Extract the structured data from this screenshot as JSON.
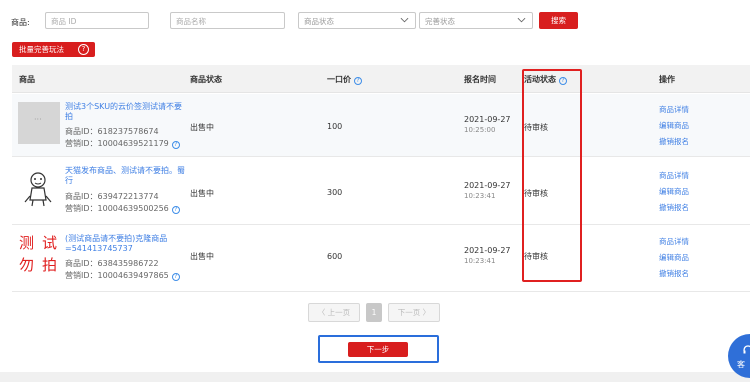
{
  "filters": {
    "label": "商品:",
    "product_id_placeholder": "商品 ID",
    "product_name_placeholder": "商品名称",
    "status_select": "商品状态",
    "completion_select": "完善状态",
    "search_button": "搜索"
  },
  "batch_button": {
    "label": "批量完善玩法",
    "help": "?"
  },
  "table": {
    "headers": {
      "product": "商品",
      "status": "商品状态",
      "price": "一口价",
      "signup_time": "报名时间",
      "activity_status": "活动状态",
      "actions": "操作"
    },
    "rows": [
      {
        "title": "测试3个SKU的云价签测试请不要拍",
        "product_id": "商品ID：618237578674",
        "marketing_id": "营销ID：10004639521179",
        "status": "出售中",
        "price": "100",
        "date": "2021-09-27",
        "time": "10:25:00",
        "activity_status": "待审核",
        "actions": [
          "商品详情",
          "编辑商品",
          "撤销报名"
        ]
      },
      {
        "title": "天猫发布商品、测试请不要拍。蜀行",
        "product_id": "商品ID：639472213774",
        "marketing_id": "营销ID：10004639500256",
        "status": "出售中",
        "price": "300",
        "date": "2021-09-27",
        "time": "10:23:41",
        "activity_status": "待审核",
        "actions": [
          "商品详情",
          "编辑商品",
          "撤销报名"
        ]
      },
      {
        "title": "(测试商品请不要拍)克隆商品=541413745737",
        "product_id": "商品ID：638435986722",
        "marketing_id": "营销ID：10004639497865",
        "thumb_text": [
          "测",
          "试",
          "勿",
          "拍"
        ],
        "status": "出售中",
        "price": "600",
        "date": "2021-09-27",
        "time": "10:23:41",
        "activity_status": "待审核",
        "actions": [
          "商品详情",
          "编辑商品",
          "撤销报名"
        ]
      }
    ]
  },
  "pagination": {
    "prev": "〈 上一页",
    "current": "1",
    "next": "下一页 〉"
  },
  "next_step": "下一步",
  "customer_service": "客",
  "colors": {
    "accent_red": "#d81e1e",
    "link_blue": "#3f7fe4",
    "highlight_red": "#e02020",
    "highlight_blue": "#2a6edb"
  }
}
